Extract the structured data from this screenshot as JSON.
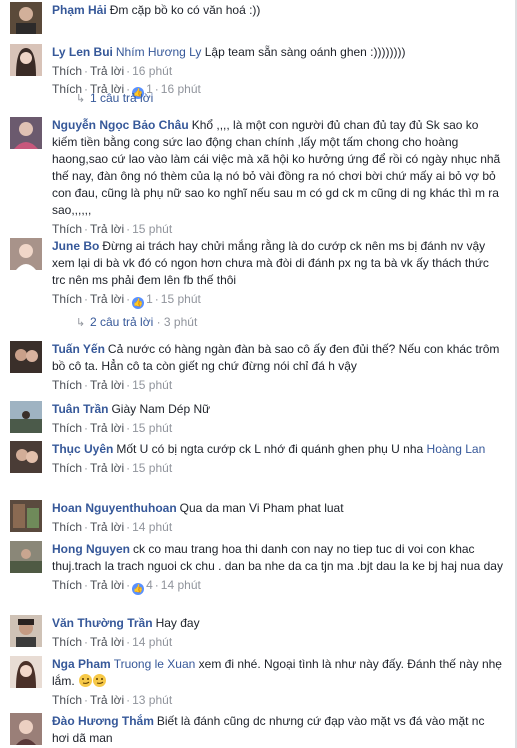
{
  "like_label": "Thích",
  "reply_label": "Trả lời",
  "comments": [
    {
      "id": "c1",
      "name": "Phạm Hải",
      "text": "Đm cặp bồ ko có văn hoá :))",
      "avatar_color": "#5b4a3a"
    },
    {
      "id": "c2",
      "name": "Ly Len Bui",
      "mention": "Nhím Hương Ly",
      "text": "Lập team sẵn sàng oánh ghen :))))))))",
      "time1": "16 phút",
      "reactions": "1",
      "time2": "16 phút",
      "avatar_color": "#c9a89a"
    },
    {
      "id": "c3",
      "name": "Nguyễn Ngọc Bảo Châu",
      "text": "Khổ ,,,, là một con người đủ chan đủ tay đủ Sk sao ko kiếm tiền bằng cong sức lao động chan chính ,lấy một tấm chong cho hoàng haong,sao cứ lao vào làm cái việc mà xã hội ko hưởng ứng để rồi có ngày nhục nhã thế nay, đàn ông nó thèm của lạ nó bỏ vài đồng ra nó chơi bời chứ mấy ai bỏ vợ bỏ con đau, cũng là phụ nữ sao ko nghĩ nếu sau m có gd ck m cũng di ng khác thì m ra sao,,,,,,",
      "time1": "15 phút",
      "avatar_color": "#6b5a6e"
    },
    {
      "id": "c4",
      "name": "June Bo",
      "text": "Đừng ai trách hay chửi mắng rằng là do cướp ck nên ms bị đánh nv vậy xem lại di bà vk đó có ngon hơn chưa mà đòi di đánh px ng ta bà vk ấy thách thức trc nên ms phải đem lên fb thế thôi",
      "reactions": "1",
      "time2": "15 phút",
      "avatar_color": "#8a7a70"
    },
    {
      "id": "c5",
      "name": "Tuấn Yến",
      "text": "Cả nước có hàng ngàn đàn bà sao cô ấy đen đủi thế? Nếu con khác trôm bồ cô ta. Hẳn cô ta còn giết ng chứ đừng nói chỉ đá h vậy",
      "time1": "15 phút",
      "avatar_color": "#3a2f2a"
    },
    {
      "id": "c6",
      "name": "Tuân Trần",
      "text": "Giày Nam Dép Nữ",
      "time1": "15 phút",
      "avatar_color": "#7b8c99"
    },
    {
      "id": "c7",
      "name": "Thục Uyên",
      "text": "Mốt U có bị ngta cướp ck L nhớ đi quánh ghen phụ U nha",
      "mention_tail": "Hoàng Lan",
      "time1": "15 phút",
      "avatar_color": "#4a3c36"
    },
    {
      "id": "c8",
      "name": "Hoan Nguyenthuhoan",
      "text": "Qua da man Vi Pham phat luat",
      "time1": "14 phút",
      "avatar_color": "#5a4a3e"
    },
    {
      "id": "c9",
      "name": "Hong Nguyen",
      "text": "ck co mau trang hoa thi danh con nay no tiep tuc di voi con khac thuj.trach la trach nguoi ck chu . dan ba nhe da ca tjn ma .bjt dau la ke bj haj nua day",
      "reactions": "4",
      "time2": "14 phút",
      "avatar_color": "#6c6a5e"
    },
    {
      "id": "c10",
      "name": "Văn Thường Trần",
      "text": "Hay đay",
      "time1": "14 phút",
      "avatar_color": "#8b7766"
    },
    {
      "id": "c11",
      "name": "Nga Pham",
      "mention": "Truong le Xuan",
      "text": "xem đi nhé. Ngoại tình là như này đấy. Đánh thế này nhẹ lắm.",
      "time1": "13 phút",
      "avatar_color": "#b99a8c"
    },
    {
      "id": "c12",
      "name": "Đào Hương Thắm",
      "text": "Biết là đánh cũng dc nhưng cứ đạp vào mặt vs đá vào mặt nc hơi dã man",
      "avatar_color": "#9a7f78"
    }
  ],
  "reply_toggles": [
    {
      "id": "t1",
      "label": "1 câu trả lời"
    },
    {
      "id": "t2",
      "label": "2 câu trả lời",
      "time": "3 phút"
    }
  ]
}
